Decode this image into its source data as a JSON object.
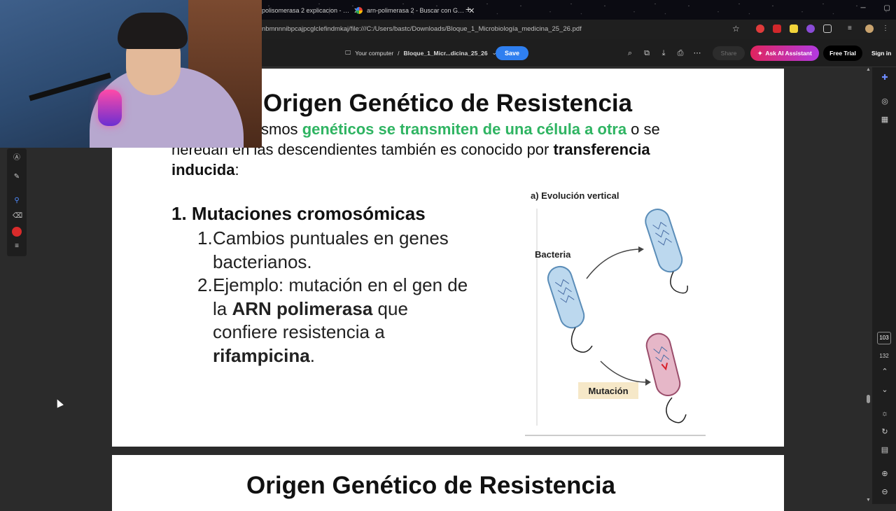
{
  "browser": {
    "tabs": [
      {
        "title": "polisomerasa 2 explicacion - …"
      },
      {
        "title": "arn-polimerasa 2 - Buscar con G…"
      }
    ],
    "url": "nbmnnnibpcajpcglclefindmkaj/file:///C:/Users/bastc/Downloads/Bloque_1_Microbiología_medicina_25_26.pdf"
  },
  "pdf_toolbar": {
    "location": "Your computer",
    "separator": "/",
    "filename": "Bloque_1_Micr...dicina_25_26",
    "save": "Save",
    "share": "Share",
    "ai_assistant": "Ask AI Assistant",
    "free_trial": "Free Trial",
    "sign_in": "Sign in"
  },
  "page_nav": {
    "current": "103",
    "total": "132"
  },
  "slide1": {
    "title": "Origen Genético de Resistencia",
    "intro_start": "smos ",
    "intro_green": "genéticos se transmiten de una célula a otra",
    "intro_mid": " o se heredan en las descendientes también es conocido por ",
    "intro_bold": "transferencia inducida",
    "intro_end": ":",
    "heading": "1. Mutaciones cromosómicas",
    "item1_num": "1.",
    "item1_text": "Cambios puntuales en genes bacterianos.",
    "item2_num": "2.",
    "item2_text_a": "Ejemplo: mutación en el gen de la ",
    "item2_bold_a": "ARN polimerasa",
    "item2_text_b": " que confiere resistencia a ",
    "item2_bold_b": "rifampicina",
    "item2_text_c": ".",
    "figure": {
      "title": "a) Evolución vertical",
      "bacteria_label": "Bacteria",
      "mutation_label": "Mutación"
    }
  },
  "slide2": {
    "title": "Origen Genético de Resistencia"
  },
  "colors": {
    "accent_green": "#2fb462",
    "save_blue": "#2f7ff0",
    "bacterium_blue": "#bcd8ee",
    "bacterium_pink": "#e6b7c8"
  }
}
